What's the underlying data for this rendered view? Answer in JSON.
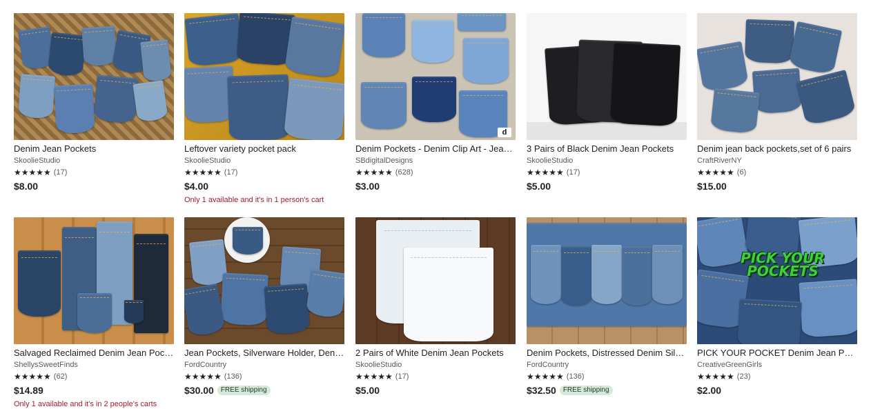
{
  "listings": [
    {
      "title": "Denim Jean Pockets",
      "shop": "SkoolieStudio",
      "stars": "★★★★★",
      "reviews": "(17)",
      "price": "$8.00",
      "badge": "",
      "note": ""
    },
    {
      "title": "Leftover variety pocket pack",
      "shop": "SkoolieStudio",
      "stars": "★★★★★",
      "reviews": "(17)",
      "price": "$4.00",
      "badge": "",
      "note": "Only 1 available and it's in 1 person's cart"
    },
    {
      "title": "Denim Pockets - Denim Clip Art - Jean Pockets",
      "shop": "SBdigitalDesigns",
      "stars": "★★★★★",
      "reviews": "(628)",
      "price": "$3.00",
      "badge": "",
      "note": ""
    },
    {
      "title": "3 Pairs of Black Denim Jean Pockets",
      "shop": "SkoolieStudio",
      "stars": "★★★★★",
      "reviews": "(17)",
      "price": "$5.00",
      "badge": "",
      "note": ""
    },
    {
      "title": "Denim jean back pockets,set of 6 pairs",
      "shop": "CraftRiverNY",
      "stars": "★★★★★",
      "reviews": "(6)",
      "price": "$15.00",
      "badge": "",
      "note": ""
    },
    {
      "title": "Salvaged Reclaimed Denim Jean Pockets",
      "shop": "ShellysSweetFinds",
      "stars": "★★★★★",
      "reviews": "(62)",
      "price": "$14.89",
      "badge": "",
      "note": "Only 1 available and it's in 2 people's carts"
    },
    {
      "title": "Jean Pockets, Silverware Holder, Denim Pockets",
      "shop": "FordCountry",
      "stars": "★★★★★",
      "reviews": "(136)",
      "price": "$30.00",
      "badge": "FREE shipping",
      "note": ""
    },
    {
      "title": "2 Pairs of White Denim Jean Pockets",
      "shop": "SkoolieStudio",
      "stars": "★★★★★",
      "reviews": "(17)",
      "price": "$5.00",
      "badge": "",
      "note": ""
    },
    {
      "title": "Denim Pockets, Distressed Denim Silverware Holder",
      "shop": "FordCountry",
      "stars": "★★★★★",
      "reviews": "(136)",
      "price": "$32.50",
      "badge": "FREE shipping",
      "note": ""
    },
    {
      "title": "PICK YOUR POCKET Denim Jean Pockets",
      "shop": "CreativeGreenGirls",
      "stars": "★★★★★",
      "reviews": "(23)",
      "price": "$2.00",
      "badge": "",
      "note": ""
    }
  ],
  "image_text": {
    "pick_your_pockets": "PICK YOUR POCKETS",
    "etsy_mark": "d"
  },
  "colors": {
    "free_shipping_bg": "#d4e9d7",
    "stock_note": "#a61a2e",
    "price": "#222222",
    "shop_name": "#595959"
  },
  "icons": {
    "star": "star-icon"
  }
}
